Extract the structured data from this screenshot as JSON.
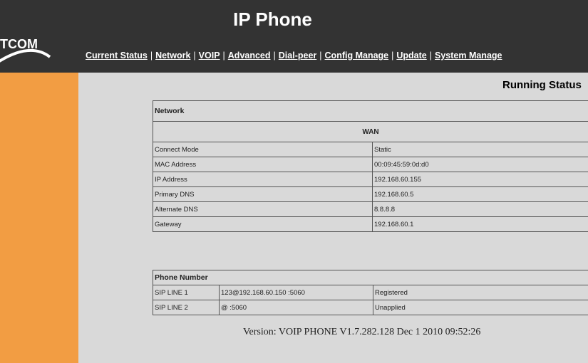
{
  "app": {
    "title": "IP Phone",
    "logo_text": "TCOM"
  },
  "nav": {
    "items": [
      {
        "label": "Current Status"
      },
      {
        "label": "Network"
      },
      {
        "label": "VOIP"
      },
      {
        "label": "Advanced"
      },
      {
        "label": "Dial-peer"
      },
      {
        "label": "Config Manage"
      },
      {
        "label": "Update"
      },
      {
        "label": "System Manage"
      }
    ]
  },
  "page": {
    "heading": "Running Status"
  },
  "network_table": {
    "title": "Network",
    "section": "WAN",
    "rows": [
      {
        "label": "Connect Mode",
        "value": "Static"
      },
      {
        "label": "MAC Address",
        "value": "00:09:45:59:0d:d0"
      },
      {
        "label": "IP Address",
        "value": "192.168.60.155"
      },
      {
        "label": "Primary DNS",
        "value": "192.168.60.5"
      },
      {
        "label": "Alternate DNS",
        "value": "8.8.8.8"
      },
      {
        "label": "Gateway",
        "value": "192.168.60.1"
      }
    ]
  },
  "phone_table": {
    "title": "Phone Number",
    "rows": [
      {
        "line": "SIP LINE 1",
        "number": "123@192.168.60.150 :5060",
        "status": "Registered"
      },
      {
        "line": "SIP LINE 2",
        "number": "@ :5060",
        "status": "Unapplied"
      }
    ]
  },
  "footer": {
    "version": "Version: VOIP PHONE V1.7.282.128 Dec 1 2010 09:52:26"
  },
  "colors": {
    "header_bg": "#333333",
    "sidebar_bg": "#f29d43",
    "content_bg": "#d9d9d9"
  }
}
